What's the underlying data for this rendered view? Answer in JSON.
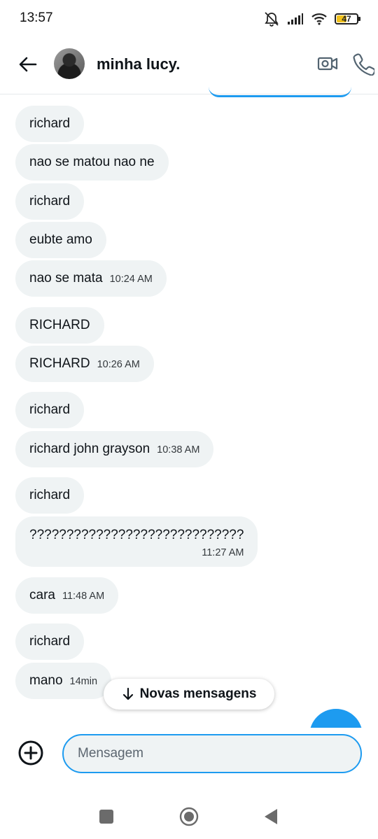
{
  "status_bar": {
    "time": "13:57",
    "battery_level": "47"
  },
  "header": {
    "contact_name": "minha lucy."
  },
  "messages": [
    {
      "text": "richard",
      "time": ""
    },
    {
      "text": "nao se matou nao ne",
      "time": ""
    },
    {
      "text": "richard",
      "time": ""
    },
    {
      "text": "eubte amo",
      "time": ""
    },
    {
      "text": "nao se mata",
      "time": "10:24 AM"
    },
    {
      "text": "RICHARD",
      "time": ""
    },
    {
      "text": "RICHARD",
      "time": "10:26 AM"
    },
    {
      "text": "richard",
      "time": ""
    },
    {
      "text": "richard john grayson",
      "time": "10:38 AM"
    },
    {
      "text": "richard",
      "time": ""
    },
    {
      "text": "?????????????????????????????",
      "time": "11:27 AM"
    },
    {
      "text": "cara",
      "time": "11:48 AM"
    },
    {
      "text": "richard",
      "time": ""
    },
    {
      "text": "mano",
      "time": "14min"
    }
  ],
  "new_messages_label": "Novas mensagens",
  "composer": {
    "placeholder": "Mensagem"
  },
  "colors": {
    "accent": "#1d9bf0",
    "bubble": "#eff3f4",
    "text": "#0f1419"
  },
  "icons": [
    "back-arrow-icon",
    "video-call-icon",
    "phone-icon",
    "add-circle-icon",
    "arrow-down-icon",
    "mute-icon",
    "signal-icon",
    "wifi-icon"
  ]
}
